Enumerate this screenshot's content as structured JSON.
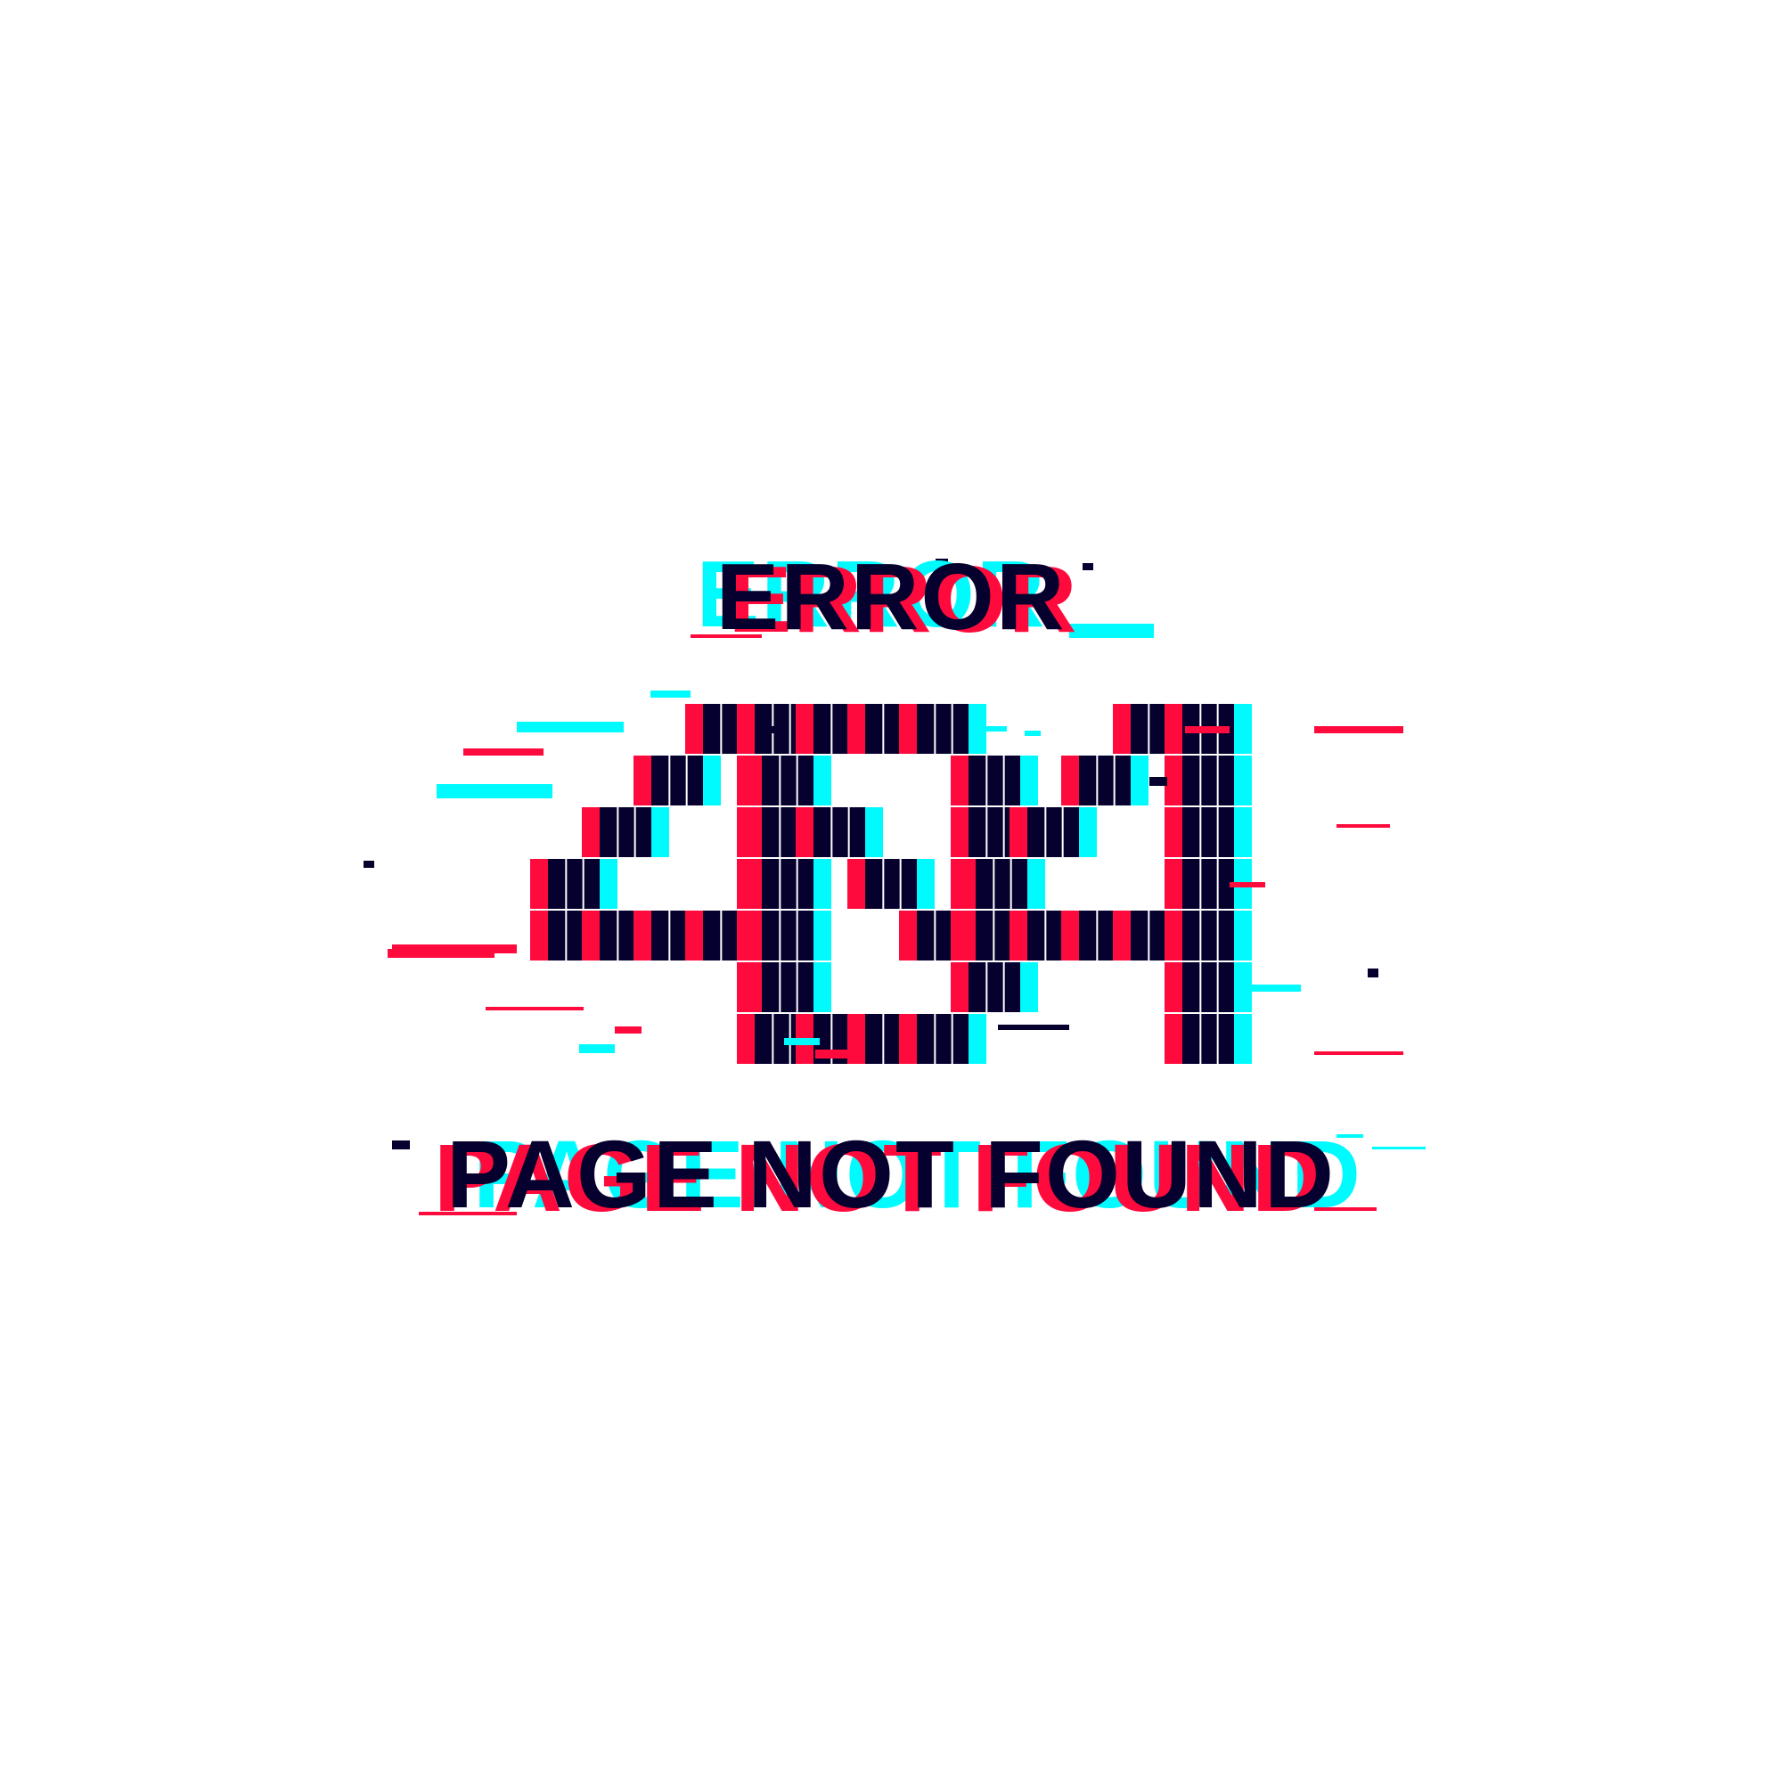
{
  "heading": "ERROR",
  "code": "404",
  "subheading": "PAGE NOT FOUND",
  "colors": {
    "background": "#ffffff",
    "red": "#ff0a3c",
    "cyan": "#00fbff",
    "navy": "#05002e"
  }
}
